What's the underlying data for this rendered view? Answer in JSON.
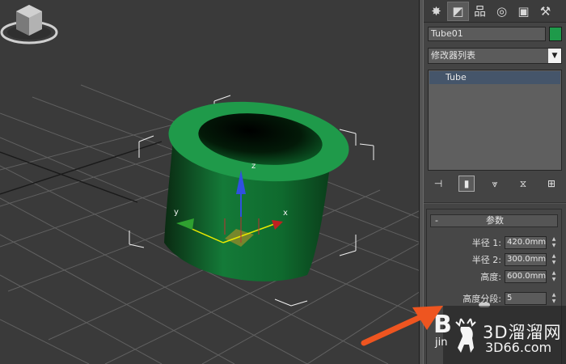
{
  "command_panel": {
    "tabs": [
      {
        "icon": "create-icon",
        "glyph": "✸"
      },
      {
        "icon": "modify-icon",
        "glyph": "◩"
      },
      {
        "icon": "hierarchy-icon",
        "glyph": "品"
      },
      {
        "icon": "motion-icon",
        "glyph": "◎"
      },
      {
        "icon": "display-icon",
        "glyph": "▣"
      },
      {
        "icon": "utilities-icon",
        "glyph": "⚒"
      }
    ],
    "object_name": "Tube01",
    "object_color": "#1e9a4a",
    "modifier_list_label": "修改器列表",
    "stack_items": [
      "Tube"
    ],
    "stack_tools": [
      {
        "icon": "pin-stack-icon",
        "glyph": "⊣"
      },
      {
        "icon": "show-end-result-icon",
        "glyph": "▮"
      },
      {
        "icon": "make-unique-icon",
        "glyph": "⩔"
      },
      {
        "icon": "remove-modifier-icon",
        "glyph": "⧖"
      },
      {
        "icon": "configure-sets-icon",
        "glyph": "⊞"
      }
    ]
  },
  "parameters": {
    "rollout_toggle": "-",
    "rollout_title": "参数",
    "radius1_label": "半径 1:",
    "radius1_value": "420.0mm",
    "radius2_label": "半径 2:",
    "radius2_value": "300.0mm",
    "height_label": "高度:",
    "height_value": "600.0mm",
    "height_segments_label": "高度分段:",
    "height_segments_value": "5"
  },
  "viewport": {
    "gizmo_x_label": "x",
    "gizmo_y_label": "y",
    "gizmo_z_label": "z",
    "object_color": "#1e8c46"
  },
  "watermark": {
    "big": "B",
    "small": "jin",
    "site_name": "3D溜溜网",
    "site_url": "3D66.com"
  }
}
